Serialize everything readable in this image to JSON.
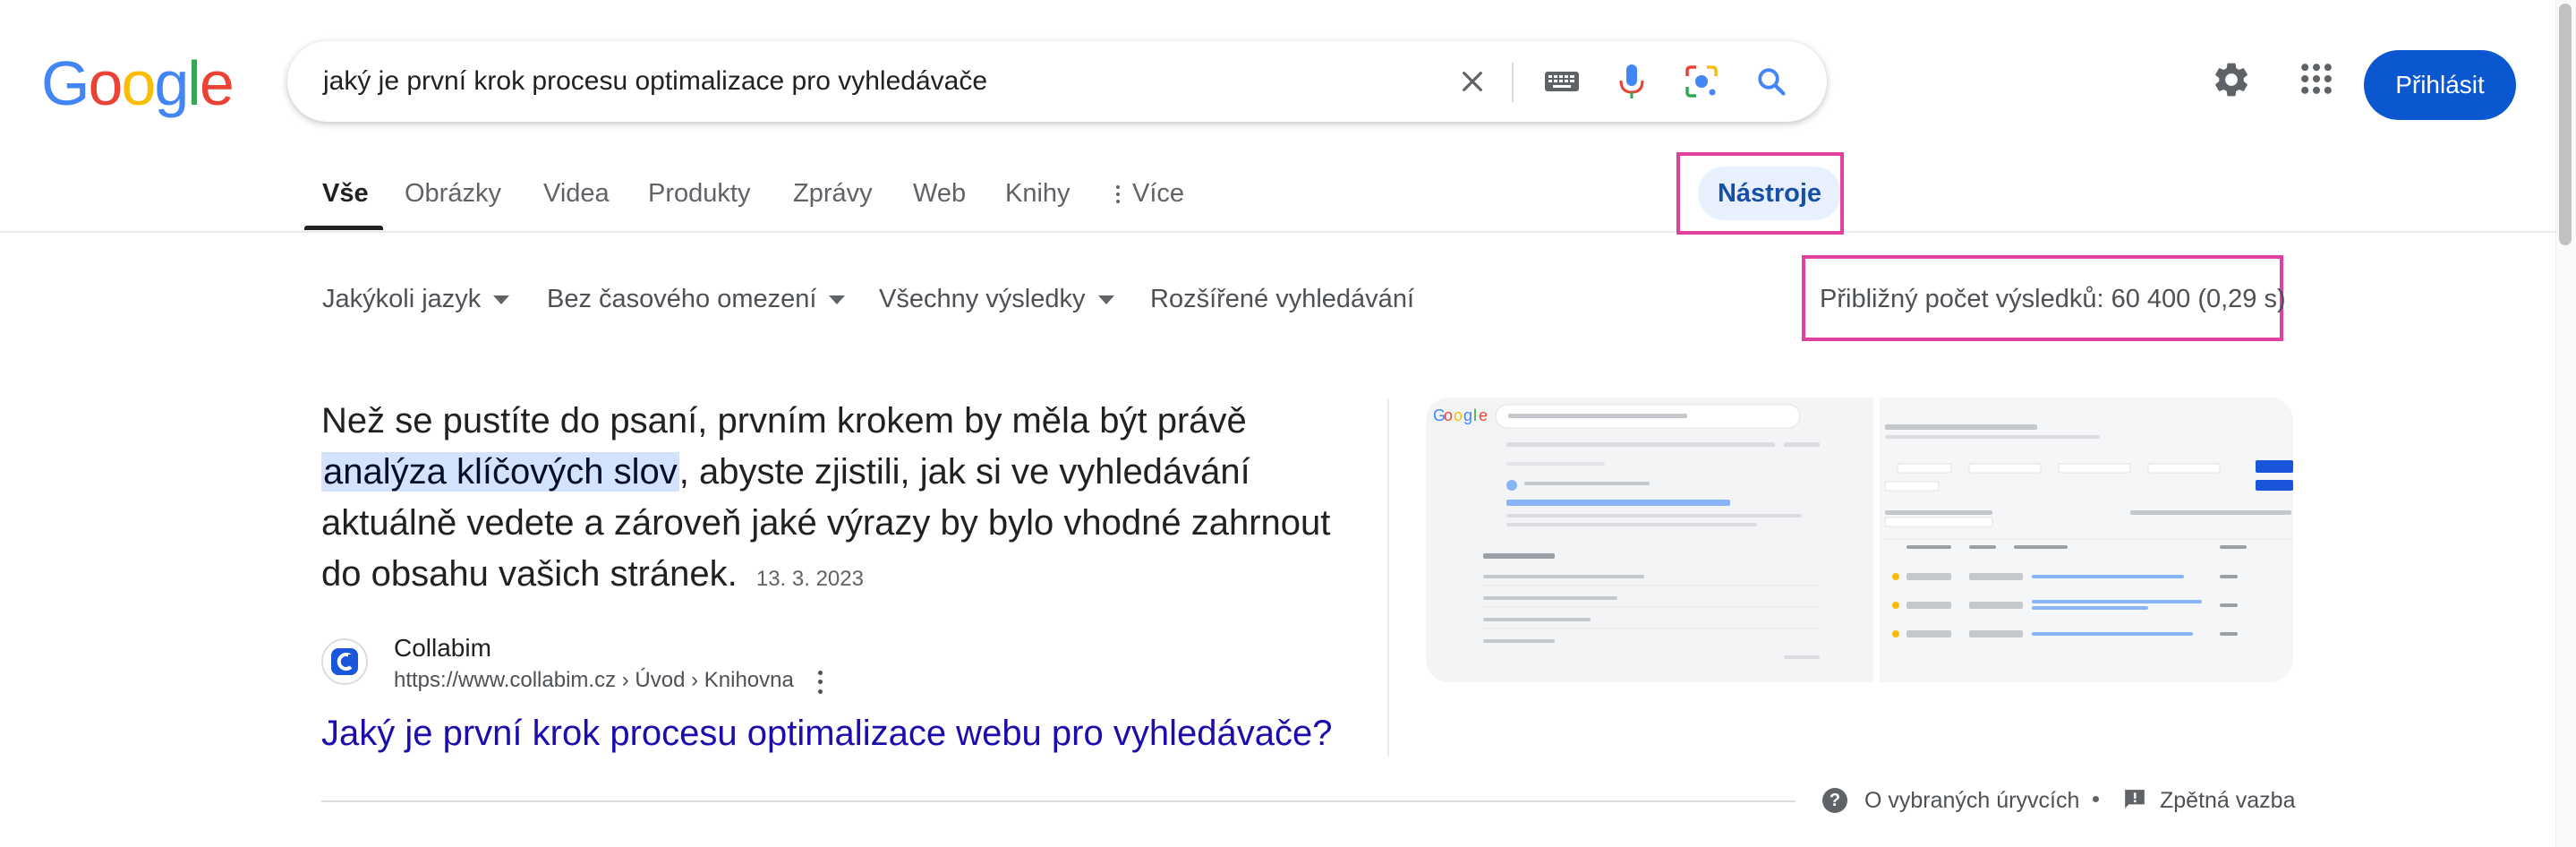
{
  "logo": [
    "G",
    "o",
    "o",
    "g",
    "l",
    "e"
  ],
  "search": {
    "query": "jaký je první krok procesu optimalizace pro vyhledávače"
  },
  "header": {
    "signin_label": "Přihlásit"
  },
  "tabs": [
    {
      "label": "Vše"
    },
    {
      "label": "Obrázky"
    },
    {
      "label": "Videa"
    },
    {
      "label": "Produkty"
    },
    {
      "label": "Zprávy"
    },
    {
      "label": "Web"
    },
    {
      "label": "Knihy"
    },
    {
      "label": "Více"
    }
  ],
  "tools_label": "Nástroje",
  "filters": [
    {
      "label": "Jakýkoli jazyk"
    },
    {
      "label": "Bez časového omezení"
    },
    {
      "label": "Všechny výsledky"
    },
    {
      "label": "Rozšířené vyhledávání"
    }
  ],
  "result_stats": "Přibližný počet výsledků: 60 400 (0,29 s)",
  "snippet": {
    "text_before": "Než se pustíte do psaní, prvním krokem by měla být právě",
    "highlight": "analýza klíčových slov",
    "text_after": ", abyste zjistili, jak si ve vyhledávání aktuálně vedete a zároveň jaké výrazy by bylo vhodné zahrnout do obsahu vašich stránek.",
    "date": "13. 3. 2023"
  },
  "source": {
    "name": "Collabim",
    "url": "https://www.collabim.cz › Úvod › Knihovna"
  },
  "result_title": "Jaký je první krok procesu optimalizace webu pro vyhledávače?",
  "footer": {
    "about_label": "O vybraných úryvcích",
    "feedback_label": "Zpětná vazba"
  },
  "colors": {
    "link": "#1a0dab",
    "highlight": "#d3e3fd",
    "annotation": "#e040a0",
    "signin_bg": "#0b57d0"
  }
}
